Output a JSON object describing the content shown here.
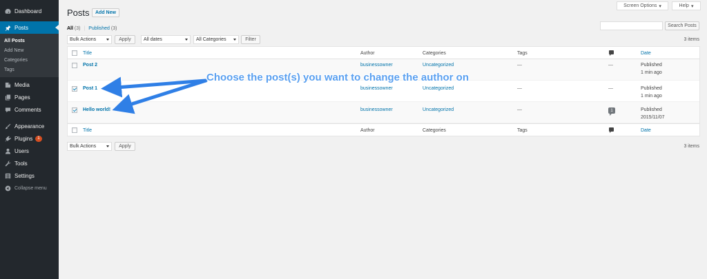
{
  "sidebar": {
    "items": [
      {
        "label": "Dashboard",
        "icon": "dashboard-icon"
      },
      {
        "label": "Posts",
        "icon": "pin-icon"
      },
      {
        "label": "Media",
        "icon": "media-icon"
      },
      {
        "label": "Pages",
        "icon": "pages-icon"
      },
      {
        "label": "Comments",
        "icon": "comments-icon"
      },
      {
        "label": "Appearance",
        "icon": "appearance-icon"
      },
      {
        "label": "Plugins",
        "icon": "plugins-icon",
        "badge": "1"
      },
      {
        "label": "Users",
        "icon": "users-icon"
      },
      {
        "label": "Tools",
        "icon": "tools-icon"
      },
      {
        "label": "Settings",
        "icon": "settings-icon"
      }
    ],
    "submenu": [
      "All Posts",
      "Add New",
      "Categories",
      "Tags"
    ],
    "collapse": "Collapse menu"
  },
  "header": {
    "screen_options": "Screen Options",
    "help": "Help",
    "title": "Posts",
    "add_new": "Add New"
  },
  "filters": {
    "all_label": "All",
    "all_count": "(3)",
    "separator": "|",
    "published_label": "Published",
    "published_count": "(3)",
    "search_button": "Search Posts",
    "bulk_actions": "Bulk Actions",
    "apply": "Apply",
    "all_dates": "All dates",
    "all_categories": "All Categories",
    "filter": "Filter",
    "items_count": "3 items"
  },
  "table": {
    "columns": {
      "title": "Title",
      "author": "Author",
      "categories": "Categories",
      "tags": "Tags",
      "date": "Date"
    },
    "rows": [
      {
        "title": "Post 2",
        "author": "businessowner",
        "category": "Uncategorized",
        "tags": "—",
        "comments": "—",
        "status": "Published",
        "when": "1 min ago",
        "checked": false
      },
      {
        "title": "Post 1",
        "author": "businessowner",
        "category": "Uncategorized",
        "tags": "—",
        "comments": "—",
        "status": "Published",
        "when": "1 min ago",
        "checked": true
      },
      {
        "title": "Hello world!",
        "author": "businessowner",
        "category": "Uncategorized",
        "tags": "—",
        "comments": "1",
        "status": "Published",
        "when": "2015/11/07",
        "checked": true
      }
    ]
  },
  "annotation": {
    "text": "Choose the post(s) you want to change the author on",
    "color": "#2f7fe6"
  },
  "colors": {
    "sidebar_bg": "#23282d",
    "active_bg": "#0073aa",
    "link": "#0073aa",
    "page_bg": "#f1f1f1"
  }
}
